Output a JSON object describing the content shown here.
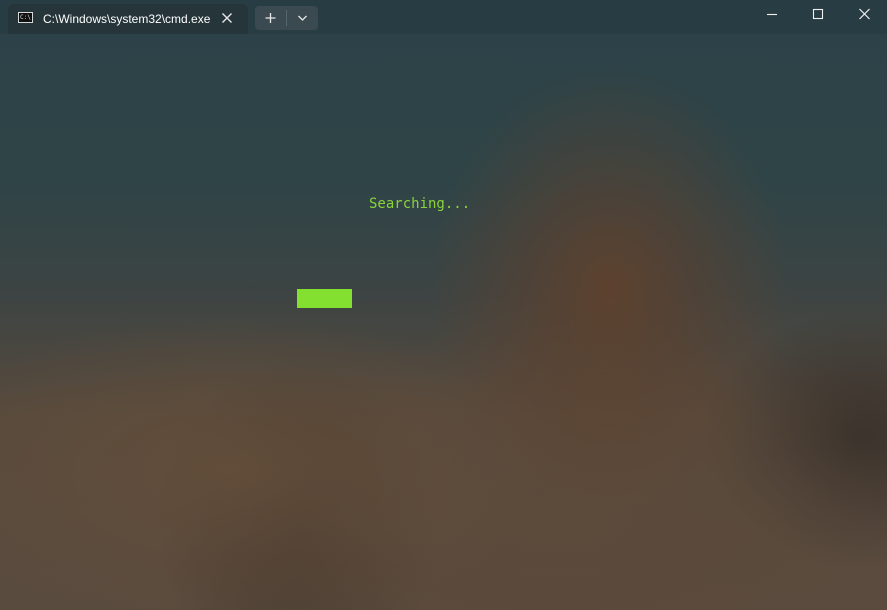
{
  "window": {
    "tab_title": "C:\\Windows\\system32\\cmd.exe",
    "tab_icon": "cmd-icon",
    "tab_icon_text": "C:\\",
    "buttons": {
      "tab_close": "close-icon",
      "new_tab": "plus-icon",
      "dropdown": "chevron-down-icon",
      "minimize": "minimize-icon",
      "maximize": "maximize-icon",
      "close": "close-icon"
    }
  },
  "terminal": {
    "output_line": "Searching...",
    "text_color": "#8ad43a",
    "cursor_color": "#84e030"
  }
}
